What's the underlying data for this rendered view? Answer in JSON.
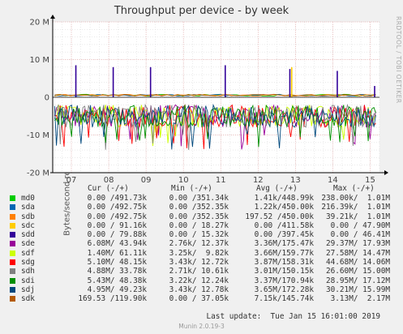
{
  "header": {
    "title": "Throughput per device - by week",
    "watermark": "RRDTOOL / TOBI OETIKER",
    "footer": "Munin 2.0.19-3",
    "last_update": "Last update:  Tue Jan 15 16:01:00 2019"
  },
  "legend_headers": {
    "cur": "Cur (-/+)",
    "min": "Min (-/+)",
    "avg": "Avg (-/+)",
    "max": "Max (-/+)"
  },
  "colors": {
    "background": "#f0f0f0",
    "plot_area": "#ffffff",
    "grid_major": "#e6a8a8",
    "grid_minor": "#dddddd",
    "zero_line": "#000000"
  },
  "legend": [
    {
      "name": "md0",
      "color": "#00cc00",
      "cur": "0.00 /491.73k",
      "min": "0.00 /351.34k",
      "avg": "1.41k/448.99k",
      "max": "238.00k/  1.01M"
    },
    {
      "name": "sda",
      "color": "#0066b3",
      "cur": "0.00 /492.75k",
      "min": "0.00 /352.35k",
      "avg": "1.22k/450.00k",
      "max": "216.39k/  1.01M"
    },
    {
      "name": "sdb",
      "color": "#ff8000",
      "cur": "0.00 /492.75k",
      "min": "0.00 /352.35k",
      "avg": "197.52 /450.00k",
      "max": "39.21k/  1.01M"
    },
    {
      "name": "sdc",
      "color": "#ffcc00",
      "cur": "0.00 / 91.16k",
      "min": "0.00 / 18.27k",
      "avg": "0.00 /411.58k",
      "max": "0.00 / 47.90M"
    },
    {
      "name": "sdd",
      "color": "#330099",
      "cur": "0.00 / 79.88k",
      "min": "0.00 / 15.32k",
      "avg": "0.00 /397.45k",
      "max": "0.00 / 46.41M"
    },
    {
      "name": "sde",
      "color": "#990099",
      "cur": "6.08M/ 43.94k",
      "min": "2.76k/ 12.37k",
      "avg": "3.36M/175.47k",
      "max": "29.37M/ 17.93M"
    },
    {
      "name": "sdf",
      "color": "#ccff00",
      "cur": "1.40M/ 61.11k",
      "min": "3.25k/  9.82k",
      "avg": "3.66M/159.77k",
      "max": "27.58M/ 14.47M"
    },
    {
      "name": "sdg",
      "color": "#ff0000",
      "cur": "5.10M/ 48.15k",
      "min": "3.43k/ 12.72k",
      "avg": "3.87M/158.31k",
      "max": "44.68M/ 14.06M"
    },
    {
      "name": "sdh",
      "color": "#808080",
      "cur": "4.88M/ 33.78k",
      "min": "2.71k/ 10.61k",
      "avg": "3.01M/150.15k",
      "max": "26.60M/ 15.00M"
    },
    {
      "name": "sdi",
      "color": "#008f00",
      "cur": "5.43M/ 48.38k",
      "min": "3.22k/ 12.24k",
      "avg": "3.37M/170.94k",
      "max": "28.95M/ 17.12M"
    },
    {
      "name": "sdj",
      "color": "#00487d",
      "cur": "4.95M/ 49.23k",
      "min": "3.43k/ 12.78k",
      "avg": "3.65M/172.28k",
      "max": "30.21M/ 15.99M"
    },
    {
      "name": "sdk",
      "color": "#b35a00",
      "cur": "169.53 /119.90k",
      "min": "0.00 / 37.05k",
      "avg": "7.15k/145.74k",
      "max": "3.13M/  2.17M"
    }
  ],
  "chart_data": {
    "type": "line",
    "title": "Throughput per device - by week",
    "ylabel": "Bytes/second read (-) / write (+)",
    "xlabel": "",
    "x_ticks": [
      "07",
      "08",
      "09",
      "10",
      "11",
      "12",
      "13",
      "14",
      "15"
    ],
    "y_ticks": [
      "20 M",
      "10 M",
      "0",
      "-10 M",
      "-20 M"
    ],
    "y_tick_values": [
      20000000,
      10000000,
      0,
      -10000000,
      -20000000
    ],
    "ylim": [
      -20000000,
      20000000
    ],
    "x_range_days": [
      6.5,
      15.25
    ],
    "grid": true,
    "legend_position": "bottom",
    "write_spikes": [
      {
        "day": 7.12,
        "value": 8500000,
        "series": "sdd"
      },
      {
        "day": 8.12,
        "value": 8000000,
        "series": "sdd"
      },
      {
        "day": 9.12,
        "value": 8000000,
        "series": "sdd"
      },
      {
        "day": 11.12,
        "value": 8500000,
        "series": "sdd"
      },
      {
        "day": 12.85,
        "value": 7500000,
        "series": "sdd"
      },
      {
        "day": 12.9,
        "value": 8000000,
        "series": "sdc"
      },
      {
        "day": 14.12,
        "value": 7000000,
        "series": "sdd"
      },
      {
        "day": 15.12,
        "value": 3000000,
        "series": "sdd"
      }
    ],
    "read_band": {
      "typical_min": -2000000,
      "typical_max": -8000000,
      "deepest": -14000000
    },
    "series": [
      {
        "name": "sde",
        "avg_read": -3360000,
        "max_read": -29370000
      },
      {
        "name": "sdf",
        "avg_read": -3660000,
        "max_read": -27580000
      },
      {
        "name": "sdg",
        "avg_read": -3870000,
        "max_read": -44680000
      },
      {
        "name": "sdh",
        "avg_read": -3010000,
        "max_read": -26600000
      },
      {
        "name": "sdi",
        "avg_read": -3370000,
        "max_read": -28950000
      },
      {
        "name": "sdj",
        "avg_read": -3650000,
        "max_read": -30210000
      }
    ]
  }
}
